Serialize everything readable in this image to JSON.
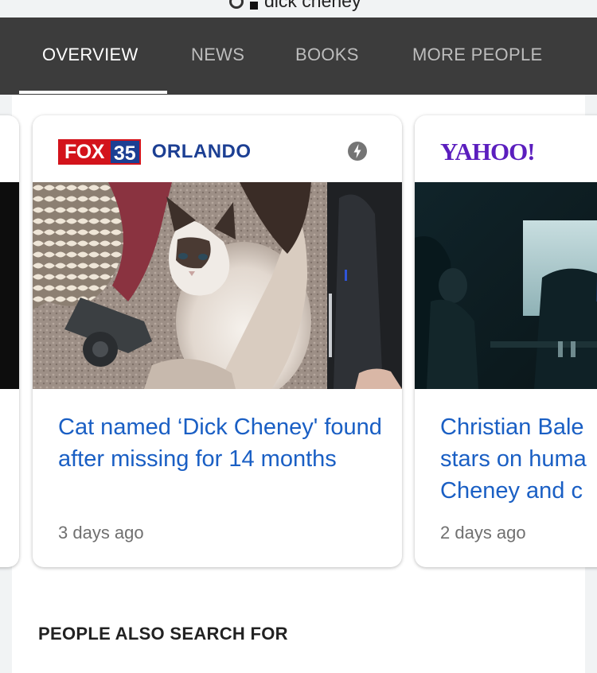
{
  "search": {
    "query": "dick cheney"
  },
  "tabs": [
    {
      "label": "OVERVIEW",
      "active": true
    },
    {
      "label": "NEWS",
      "active": false
    },
    {
      "label": "BOOKS",
      "active": false
    },
    {
      "label": "MORE PEOPLE",
      "active": false
    }
  ],
  "cards": [
    {
      "source": {
        "brand": "FOX",
        "number": "35",
        "city": "ORLANDO"
      },
      "amp_icon": "lightning-icon",
      "image_desc": "cat-photo",
      "title": "Cat named ‘Dick Cheney' found after missing for 14 months",
      "age": "3 days ago"
    },
    {
      "source": {
        "name": "YAHOO!"
      },
      "image_desc": "film-still-photo",
      "title": "Christian Bale stars on huma Cheney and c",
      "title_lines": [
        "Christian Bale",
        "stars on huma",
        "Cheney and c"
      ],
      "age": "2 days ago"
    }
  ],
  "section": {
    "heading": "PEOPLE ALSO SEARCH FOR"
  },
  "colors": {
    "tabbar_bg": "#3c3c3c",
    "link_blue": "#1a5fc4",
    "fox_red": "#d3131b",
    "fox_blue": "#1c3f93",
    "yahoo_purple": "#5b1ebe"
  }
}
